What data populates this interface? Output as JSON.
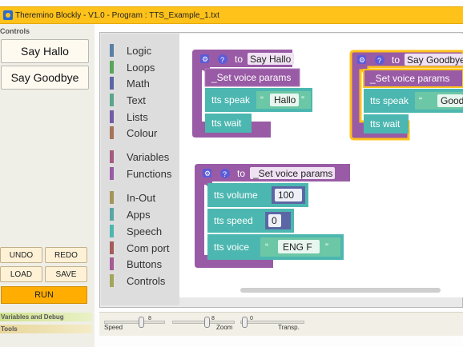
{
  "titlebar": {
    "title": "Theremino Blockly - V1.0 - Program : TTS_Example_1.txt"
  },
  "left_panel": {
    "controls_label": "Controls",
    "buttons": [
      "Say Hallo",
      "Say Goodbye"
    ],
    "undo": "UNDO",
    "redo": "REDO",
    "load": "LOAD",
    "save": "SAVE",
    "run": "RUN",
    "sections": [
      "Variables and Debug",
      "Tools"
    ]
  },
  "toolbox": {
    "categories": [
      {
        "label": "Logic",
        "color": "#5b80a5"
      },
      {
        "label": "Loops",
        "color": "#5ba55b"
      },
      {
        "label": "Math",
        "color": "#5b67a5"
      },
      {
        "label": "Text",
        "color": "#5ba58c"
      },
      {
        "label": "Lists",
        "color": "#745ba5"
      },
      {
        "label": "Colour",
        "color": "#a5745b"
      },
      {
        "label": "Variables",
        "color": "#a55b80"
      },
      {
        "label": "Functions",
        "color": "#995ba5"
      },
      {
        "label": "In-Out",
        "color": "#a5955b"
      },
      {
        "label": "Apps",
        "color": "#5ba5a5"
      },
      {
        "label": "Speech",
        "color": "#4cb7b0"
      },
      {
        "label": "Com port",
        "color": "#a55b5b"
      },
      {
        "label": "Buttons",
        "color": "#a55b95"
      },
      {
        "label": "Controls",
        "color": "#a5a55b"
      }
    ]
  },
  "blocks": {
    "say_hallo": {
      "to": "to",
      "name": "Say Hallo",
      "call": "_Set voice params",
      "speak_label": "tts speak",
      "speak_text": "Hallo",
      "wait_label": "tts wait"
    },
    "say_goodbye": {
      "to": "to",
      "name": "Say Goodbye",
      "call": "_Set voice params",
      "speak_label": "tts speak",
      "speak_text": "Good",
      "wait_label": "tts wait"
    },
    "set_voice": {
      "to": "to",
      "name": "_Set voice params",
      "volume_label": "tts volume",
      "volume_value": "100",
      "speed_label": "tts speed",
      "speed_value": "0",
      "voice_label": "tts voice",
      "voice_value": "ENG F"
    },
    "quote_open": "“",
    "quote_close": "”"
  },
  "bottom_bar": {
    "speed_label": "Speed",
    "speed_value": "8",
    "zoom_label": "Zoom",
    "zoom_value": "8",
    "transp_label": "Transp.",
    "transp_value": "0"
  },
  "colors": {
    "accent": "#ffc21a",
    "procedure": "#995ba5",
    "speech": "#4cb7b0",
    "run": "#ffad00"
  }
}
